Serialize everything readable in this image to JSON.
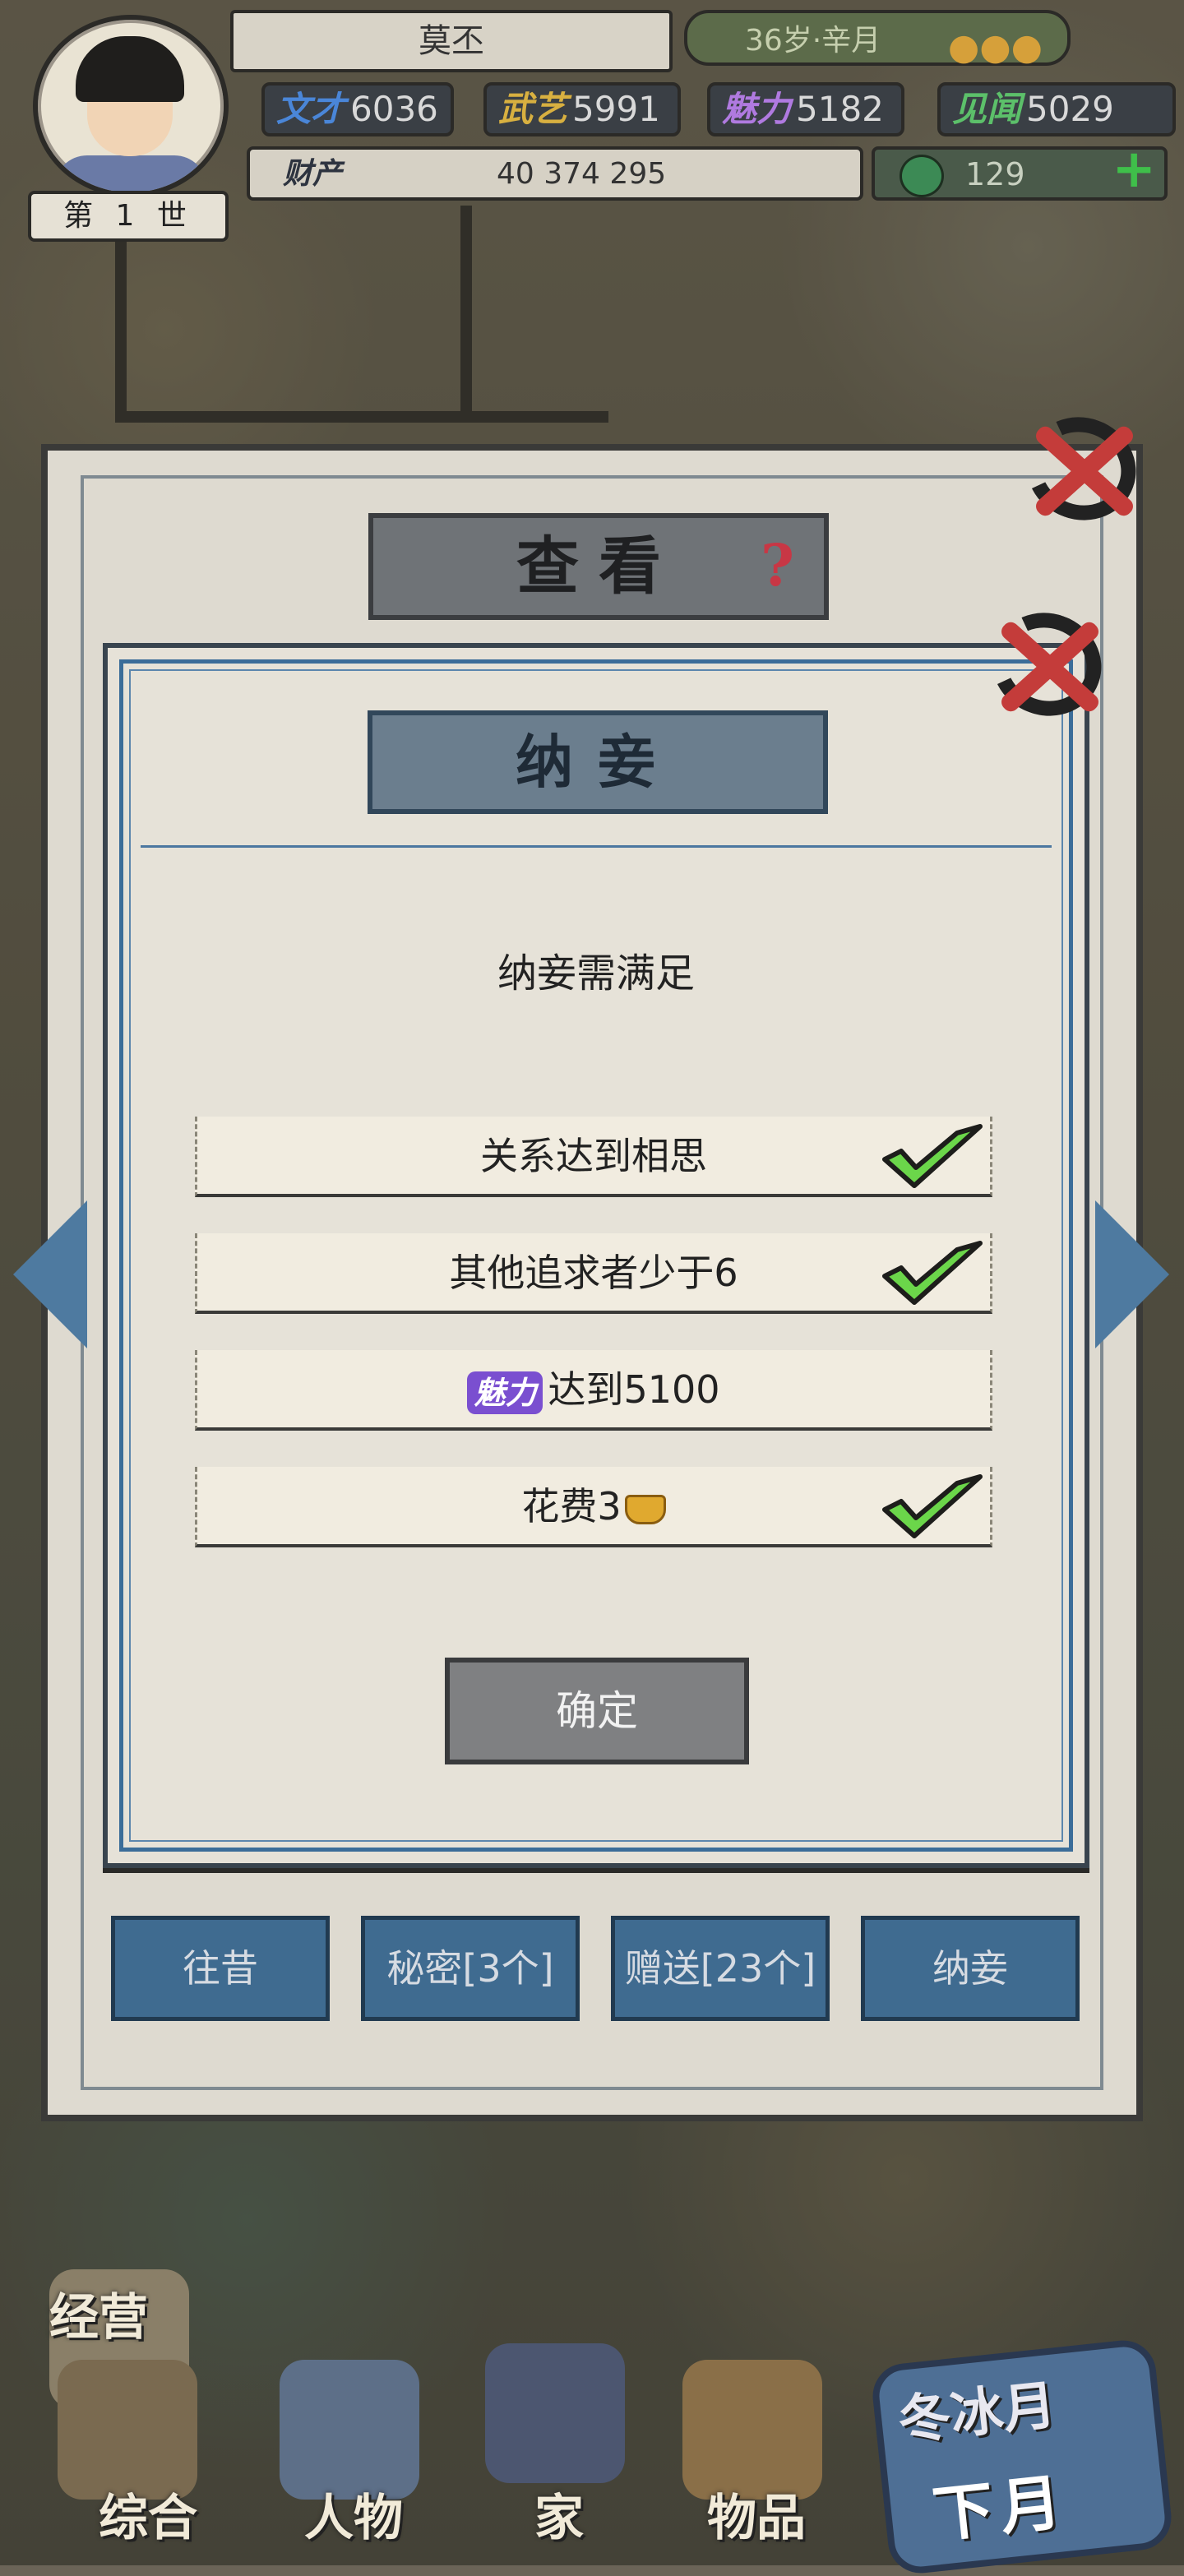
{
  "hud": {
    "generation": "第 1 世",
    "name": "莫丕",
    "age": "36岁·辛月",
    "stats": {
      "wencai_label": "文才",
      "wencai": "6036",
      "wuyi_label": "武艺",
      "wuyi": "5991",
      "meili_label": "魅力",
      "meili": "5182",
      "jianwen_label": "见闻",
      "jianwen": "5029"
    },
    "wealth_label": "财产",
    "wealth_values": "40  374  295",
    "jade": "129"
  },
  "outer_dialog": {
    "title": "查看",
    "help_glyph": "?"
  },
  "inner_dialog": {
    "title": "纳妾",
    "subtitle": "纳妾需满足",
    "requirements": [
      {
        "text": "关系达到相思",
        "met": true
      },
      {
        "text": "其他追求者少于6",
        "met": true
      },
      {
        "tag": "魅力",
        "text": "达到5100",
        "met": false
      },
      {
        "text": "花费3",
        "met": true
      }
    ],
    "confirm_label": "确定"
  },
  "tabs": [
    "往昔",
    "秘密[3个]",
    "赠送[23个]",
    "纳妾"
  ],
  "nav": {
    "jingying": "经营",
    "zonghe": "综合",
    "renwu": "人物",
    "jia": "家",
    "wupin": "物品",
    "season_month": "冬冰月",
    "next_month": "下月"
  },
  "colors": {
    "accent_blue": "#3f6b90",
    "check_green": "#6bd64a",
    "close_red": "#c43c3a",
    "charm_purple": "#7a4fd0"
  }
}
